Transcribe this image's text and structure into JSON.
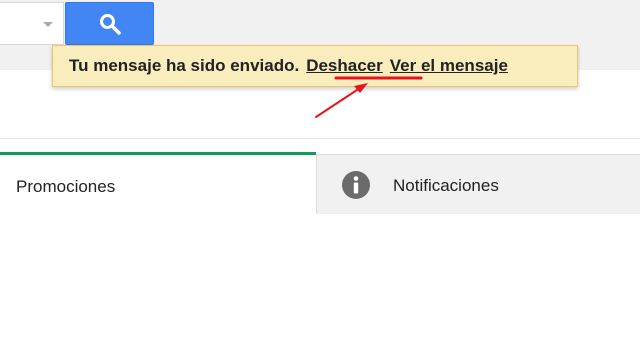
{
  "search": {
    "dropdown_icon": "chevron-down-icon",
    "button_icon": "search-icon",
    "button_color": "#4285f4"
  },
  "toast": {
    "message": "Tu mensaje ha sido enviado.",
    "undo_link": "Deshacer",
    "view_link": "Ver el mensaje",
    "background": "#f9edbe"
  },
  "tabs": [
    {
      "label": "Promociones",
      "icon": "",
      "active": true,
      "accent": "#0f9d58"
    },
    {
      "label": "Notificaciones",
      "icon": "info-icon",
      "active": false
    }
  ],
  "annotation": {
    "color": "#e8141b",
    "highlights": "Deshacer"
  }
}
